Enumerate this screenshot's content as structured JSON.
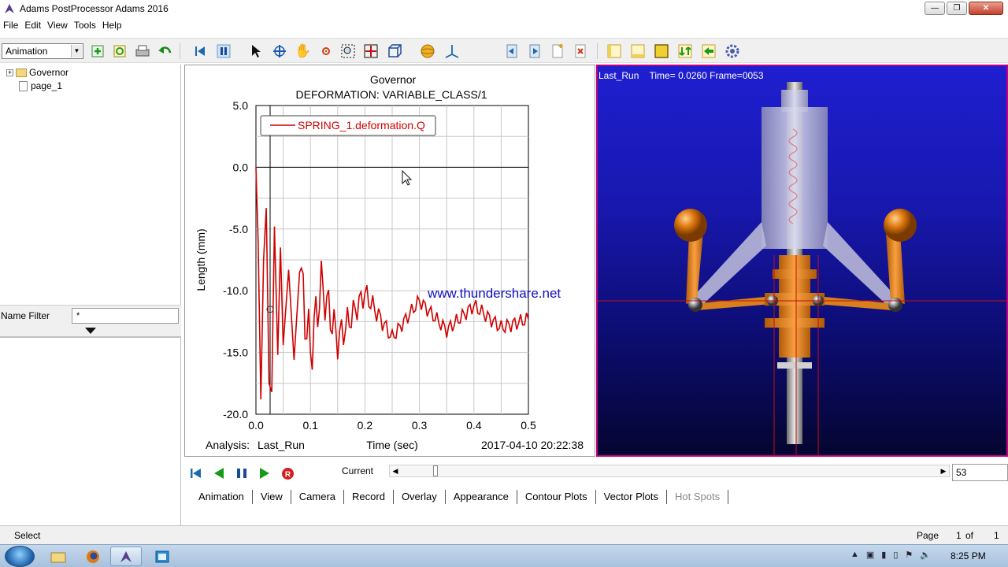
{
  "window": {
    "title": "Adams PostProcessor Adams 2016",
    "minimize": "—",
    "maximize": "❐",
    "close": "✕"
  },
  "menu": [
    "File",
    "Edit",
    "View",
    "Tools",
    "Help"
  ],
  "toolbar": {
    "mode": "Animation"
  },
  "tree": [
    {
      "label": "Governor",
      "type": "folder"
    },
    {
      "label": "page_1",
      "type": "page"
    }
  ],
  "filter": {
    "label": "Name Filter",
    "value": "*"
  },
  "chart_data": {
    "type": "line",
    "title": "Governor",
    "subtitle": "DEFORMATION: VARIABLE_CLASS/1",
    "xlabel": "Time (sec)",
    "ylabel": "Length (mm)",
    "xlim": [
      0.0,
      0.5
    ],
    "ylim": [
      -20.0,
      5.0
    ],
    "xticks": [
      "0.0",
      "0.1",
      "0.2",
      "0.3",
      "0.4",
      "0.5"
    ],
    "yticks": [
      "5.0",
      "0.0",
      "-5.0",
      "-10.0",
      "-15.0",
      "-20.0"
    ],
    "series": [
      {
        "name": "SPRING_1.deformation.Q",
        "color": "#d00000",
        "x": [
          0.0,
          0.004,
          0.009,
          0.014,
          0.019,
          0.024,
          0.029,
          0.034,
          0.04,
          0.045,
          0.05,
          0.06,
          0.07,
          0.08,
          0.1,
          0.12,
          0.15,
          0.2,
          0.25,
          0.3,
          0.35,
          0.4,
          0.45,
          0.5
        ],
        "y": [
          0.0,
          -6.0,
          -18.8,
          -7.5,
          -3.3,
          -17.5,
          -18.2,
          -4.8,
          -15.2,
          -6.5,
          -14.4,
          -8.3,
          -15.6,
          -8.5,
          -15.0,
          -9.5,
          -14.0,
          -10.2,
          -13.8,
          -10.8,
          -13.2,
          -11.2,
          -13.0,
          -12.3
        ]
      }
    ],
    "cursor_x": 0.026,
    "grid": true,
    "legend": "top-left",
    "analysis_label": "Analysis:",
    "analysis_value": "Last_Run",
    "timestamp": "2017-04-10 20:22:38"
  },
  "watermark": "www.thundershare.net",
  "view3d": {
    "run": "Last_Run",
    "time_label": "Time=",
    "time_value": "0.0260",
    "frame_label": "Frame=",
    "frame_value": "0053"
  },
  "animation": {
    "current_label": "Current",
    "frame_number": "53",
    "progress": 0.06
  },
  "tabs": [
    "Animation",
    "View",
    "Camera",
    "Record",
    "Overlay",
    "Appearance",
    "Contour Plots",
    "Vector Plots",
    "Hot Spots"
  ],
  "status": {
    "mode": "Select",
    "page_label": "Page",
    "page": "1",
    "of_label": "of",
    "total": "1"
  },
  "taskbar": {
    "time": "8:25 PM"
  },
  "colors": {
    "accent": "#c00080",
    "curve": "#d00000",
    "view_bg": "#1818b0",
    "mass": "#e08a18",
    "sphere": "#e07a10"
  }
}
